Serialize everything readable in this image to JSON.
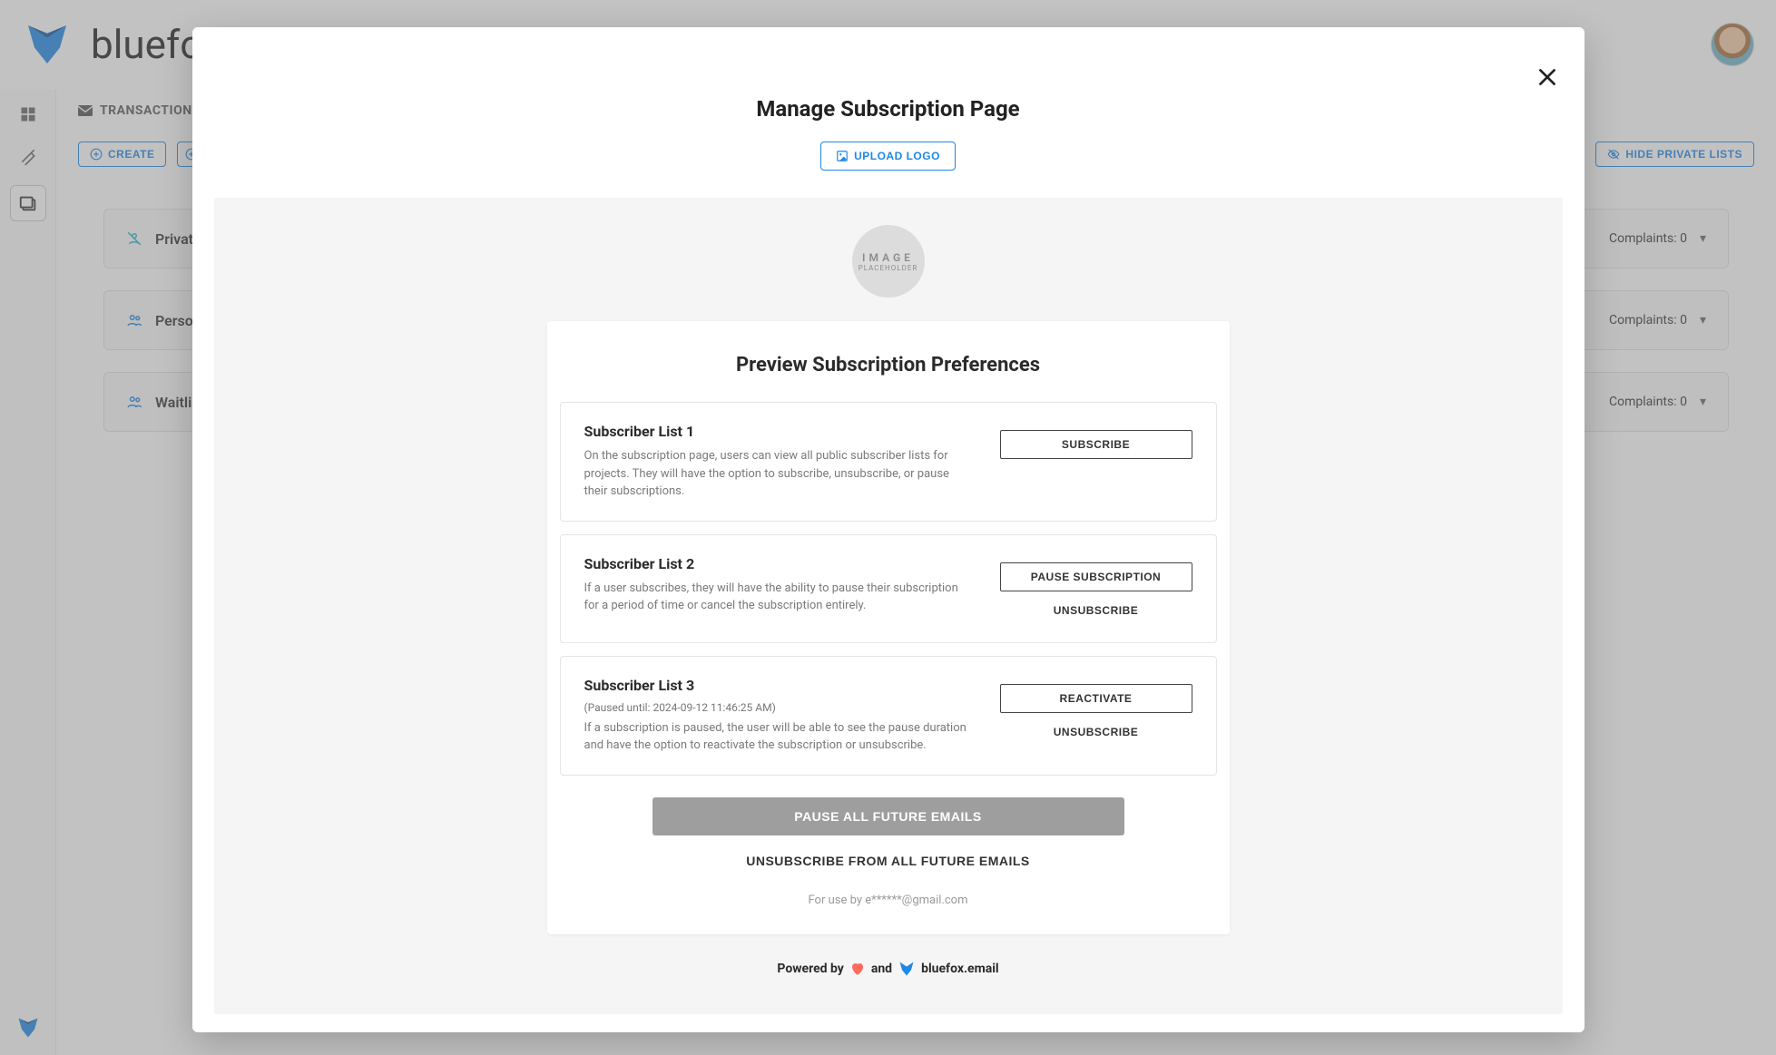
{
  "header": {
    "title": "bluefox.email"
  },
  "tabs": {
    "active": "TRANSACTIONAL"
  },
  "actions": {
    "create": "CREATE",
    "hide_private": "HIDE PRIVATE LISTS"
  },
  "lists": [
    {
      "name": "Private",
      "complaints": "Complaints: 0"
    },
    {
      "name": "Personal",
      "complaints": "Complaints: 0"
    },
    {
      "name": "Waitlist",
      "complaints": "Complaints: 0"
    }
  ],
  "dialog": {
    "title": "Manage Subscription Page",
    "upload": "UPLOAD LOGO",
    "placeholder": {
      "l1": "IMAGE",
      "l2": "PLACEHOLDER"
    },
    "pref_title": "Preview Subscription Preferences",
    "items": [
      {
        "name": "Subscriber List 1",
        "paused": "",
        "desc": "On the subscription page, users can view all public subscriber lists for projects. They will have the option to subscribe, unsubscribe, or pause their subscriptions.",
        "primary": "SUBSCRIBE",
        "secondary": ""
      },
      {
        "name": "Subscriber List 2",
        "paused": "",
        "desc": "If a user subscribes, they will have the ability to pause their subscription for a period of time or cancel the subscription entirely.",
        "primary": "PAUSE SUBSCRIPTION",
        "secondary": "UNSUBSCRIBE"
      },
      {
        "name": "Subscriber List 3",
        "paused": "(Paused until: 2024-09-12 11:46:25 AM)",
        "desc": "If a subscription is paused, the user will be able to see the pause duration and have the option to reactivate the subscription or unsubscribe.",
        "primary": "REACTIVATE",
        "secondary": "UNSUBSCRIBE"
      }
    ],
    "pause_all": "PAUSE ALL FUTURE EMAILS",
    "unsubscribe_all": "UNSUBSCRIBE FROM ALL FUTURE EMAILS",
    "for_use": "For use by e******@gmail.com",
    "powered_prefix": "Powered  by",
    "powered_and": "and",
    "powered_brand": "bluefox.email"
  }
}
